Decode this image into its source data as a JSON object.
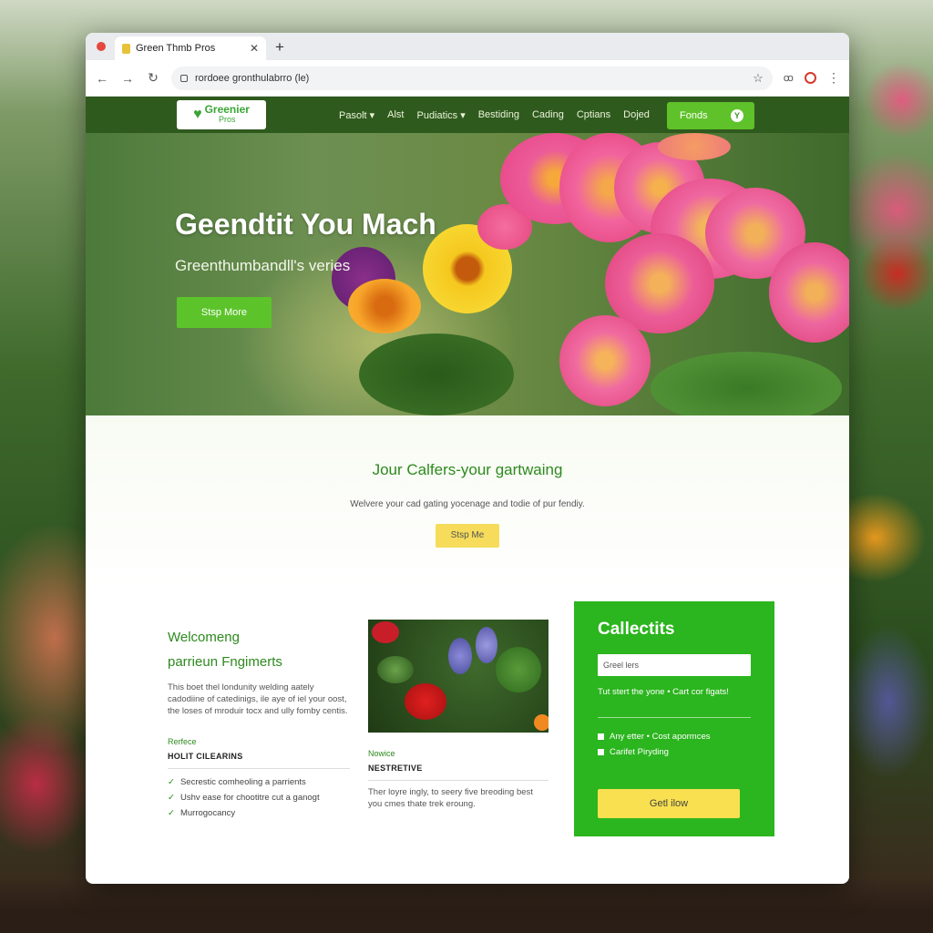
{
  "browser": {
    "tab_title": "Green Thmb Pros",
    "url": "rordoee gronthulabrro (le)"
  },
  "site": {
    "logo_text": "Greenier",
    "logo_sub": "Pros",
    "nav": [
      "Pasolt ▾",
      "Alst",
      "Pudiatics ▾",
      "Bestiding",
      "Cading",
      "Cptians",
      "Dojed"
    ],
    "cta_label": "Fonds",
    "cta_icon": "Y"
  },
  "hero": {
    "title": "Geendtit You Mach",
    "subtitle": "Greenthumbandll's veries",
    "button": "Stsp More"
  },
  "welcome": {
    "title": "Jour Calfers-your gartwaing",
    "text": "Welvere your cad gating yocenage and todie of pur fendiy.",
    "button": "Stsp Me"
  },
  "left_column": {
    "heading_line1": "Welcomeng",
    "heading_line2": "parrieun Fngimerts",
    "paragraph": "This boet thel londunity welding aately cadodiine of catedinigs, ile aye of iel your oost, the loses of mroduir tocx and ully fomby centis.",
    "label": "Rerfece",
    "section_head": "HOLIT CILEARINS",
    "checks": [
      "Secrestic comheoling a parrients",
      "Ushv ease for chootitre cut a ganogt",
      "Murrogocancy"
    ]
  },
  "middle_column": {
    "label": "Nowice",
    "section_head": "NESTRETIVE",
    "text": "Ther loyre ingly, to seery five breoding best you cmes thate trek eroung."
  },
  "panel": {
    "title": "Callectits",
    "input_value": "Greel lers",
    "note": "Tut stert the yone   •  Cart cor figats!",
    "options": [
      "Any etter  •  Cost apormces",
      "Carifet Piryding"
    ],
    "button": "Getl ilow"
  }
}
